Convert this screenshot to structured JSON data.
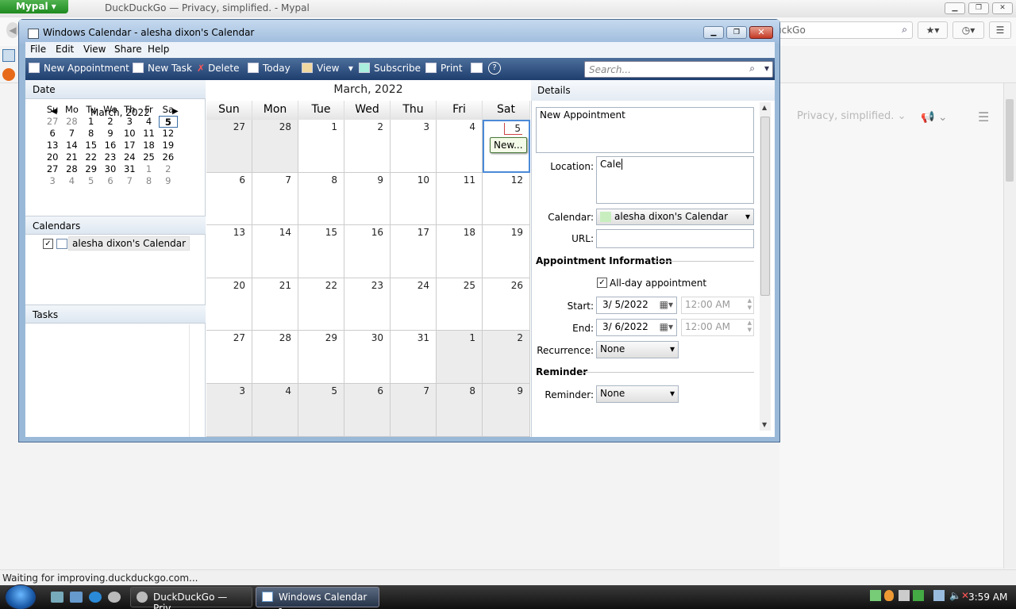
{
  "browser": {
    "app_button": "Mypal",
    "title": "DuckDuckGo — Privacy, simplified. - Mypal",
    "search_box_text": "uckGo",
    "ddg_tagline": "Privacy, simplified.",
    "status": "Waiting for improving.duckduckgo.com..."
  },
  "calendar": {
    "window_title": "Windows Calendar - alesha dixon's Calendar",
    "menu": [
      "File",
      "Edit",
      "View",
      "Share",
      "Help"
    ],
    "toolbar": {
      "new_appointment": "New Appointment",
      "new_task": "New Task",
      "delete": "Delete",
      "today": "Today",
      "view": "View",
      "subscribe": "Subscribe",
      "print": "Print"
    },
    "search_placeholder": "Search...",
    "left": {
      "date_header": "Date",
      "mini_month": "March, 2022",
      "weekdays": [
        "Su",
        "Mo",
        "Tu",
        "We",
        "Th",
        "Fr",
        "Sa"
      ],
      "weeks": [
        [
          "27",
          "28",
          "1",
          "2",
          "3",
          "4",
          "5"
        ],
        [
          "6",
          "7",
          "8",
          "9",
          "10",
          "11",
          "12"
        ],
        [
          "13",
          "14",
          "15",
          "16",
          "17",
          "18",
          "19"
        ],
        [
          "20",
          "21",
          "22",
          "23",
          "24",
          "25",
          "26"
        ],
        [
          "27",
          "28",
          "29",
          "30",
          "31",
          "1",
          "2"
        ],
        [
          "3",
          "4",
          "5",
          "6",
          "7",
          "8",
          "9"
        ]
      ],
      "calendars_header": "Calendars",
      "calendar_name": "alesha dixon's Calendar",
      "tasks_header": "Tasks"
    },
    "month": {
      "title": "March, 2022",
      "day_headers": [
        "Sun",
        "Mon",
        "Tue",
        "Wed",
        "Thu",
        "Fri",
        "Sat"
      ],
      "weeks": [
        [
          "27",
          "28",
          "1",
          "2",
          "3",
          "4",
          "5"
        ],
        [
          "6",
          "7",
          "8",
          "9",
          "10",
          "11",
          "12"
        ],
        [
          "13",
          "14",
          "15",
          "16",
          "17",
          "18",
          "19"
        ],
        [
          "20",
          "21",
          "22",
          "23",
          "24",
          "25",
          "26"
        ],
        [
          "27",
          "28",
          "29",
          "30",
          "31",
          "1",
          "2"
        ],
        [
          "3",
          "4",
          "5",
          "6",
          "7",
          "8",
          "9"
        ]
      ],
      "new_item_label": "New..."
    },
    "details": {
      "header": "Details",
      "title_value": "New Appointment",
      "location_label": "Location:",
      "location_value": "Cale",
      "calendar_label": "Calendar:",
      "calendar_value": "alesha dixon's Calendar",
      "url_label": "URL:",
      "url_value": "",
      "appointment_info_header": "Appointment Information",
      "all_day_label": "All-day appointment",
      "all_day_checked": true,
      "start_label": "Start:",
      "start_date": "3/ 5/2022",
      "start_time": "12:00 AM",
      "end_label": "End:",
      "end_date": "3/ 6/2022",
      "end_time": "12:00 AM",
      "recurrence_label": "Recurrence:",
      "recurrence_value": "None",
      "reminder_header": "Reminder",
      "reminder_label": "Reminder:",
      "reminder_value": "None"
    }
  },
  "taskbar": {
    "tasks": [
      "DuckDuckGo — Priv...",
      "Windows Calendar -..."
    ],
    "clock": "3:59 AM"
  }
}
